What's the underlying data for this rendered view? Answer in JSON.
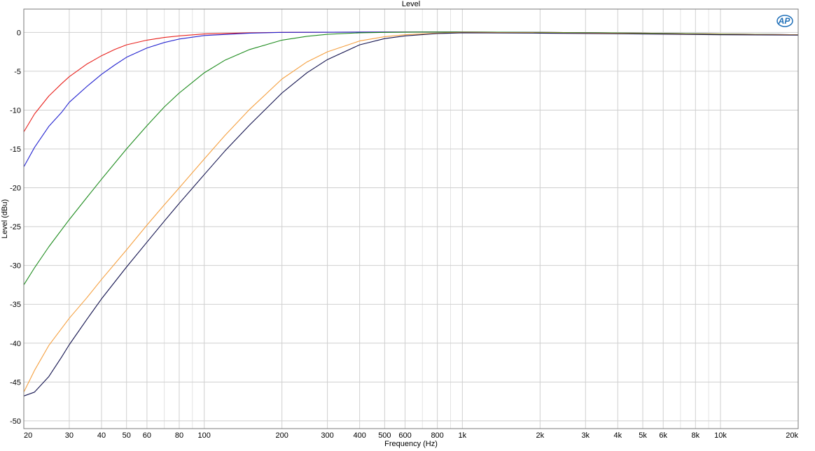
{
  "chart_data": {
    "type": "line",
    "title": "Level",
    "xlabel": "Frequency (Hz)",
    "ylabel": "Level (dBu)",
    "xscale": "log",
    "xlim": [
      20,
      20000
    ],
    "ylim": [
      -51,
      3
    ],
    "grid": true,
    "logo_text": "AP",
    "x_ticks": [
      {
        "value": 20,
        "label": "20"
      },
      {
        "value": 30,
        "label": "30"
      },
      {
        "value": 40,
        "label": "40"
      },
      {
        "value": 50,
        "label": "50"
      },
      {
        "value": 60,
        "label": "60"
      },
      {
        "value": 80,
        "label": "80"
      },
      {
        "value": 100,
        "label": "100"
      },
      {
        "value": 200,
        "label": "200"
      },
      {
        "value": 300,
        "label": "300"
      },
      {
        "value": 400,
        "label": "400"
      },
      {
        "value": 500,
        "label": "500"
      },
      {
        "value": 600,
        "label": "600"
      },
      {
        "value": 800,
        "label": "800"
      },
      {
        "value": 1000,
        "label": "1k"
      },
      {
        "value": 2000,
        "label": "2k"
      },
      {
        "value": 3000,
        "label": "3k"
      },
      {
        "value": 4000,
        "label": "4k"
      },
      {
        "value": 5000,
        "label": "5k"
      },
      {
        "value": 6000,
        "label": "6k"
      },
      {
        "value": 8000,
        "label": "8k"
      },
      {
        "value": 10000,
        "label": "10k"
      },
      {
        "value": 20000,
        "label": "20k"
      }
    ],
    "y_ticks": [
      0,
      -5,
      -10,
      -15,
      -20,
      -25,
      -30,
      -35,
      -40,
      -45,
      -50
    ],
    "series": [
      {
        "color": "#e8201c",
        "x": [
          20,
          22,
          25,
          28,
          30,
          35,
          40,
          45,
          50,
          60,
          70,
          80,
          100,
          150,
          200,
          500,
          1000,
          2000,
          5000,
          10000,
          20000
        ],
        "y": [
          -12.8,
          -10.5,
          -8.2,
          -6.6,
          -5.7,
          -4.1,
          -3.0,
          -2.2,
          -1.6,
          -1.0,
          -0.65,
          -0.45,
          -0.2,
          -0.05,
          0.0,
          0.05,
          0.05,
          0.0,
          -0.1,
          -0.2,
          -0.3
        ]
      },
      {
        "color": "#2424d0",
        "x": [
          20,
          22,
          25,
          28,
          30,
          35,
          40,
          45,
          50,
          60,
          70,
          80,
          100,
          150,
          200,
          500,
          1000,
          2000,
          5000,
          10000,
          20000
        ],
        "y": [
          -17.3,
          -14.8,
          -12.1,
          -10.3,
          -9.0,
          -7.0,
          -5.4,
          -4.2,
          -3.2,
          -2.0,
          -1.3,
          -0.85,
          -0.4,
          -0.1,
          0.0,
          0.05,
          0.05,
          0.0,
          -0.1,
          -0.2,
          -0.3
        ]
      },
      {
        "color": "#1e8c1e",
        "x": [
          20,
          22,
          25,
          30,
          35,
          40,
          50,
          60,
          70,
          80,
          100,
          120,
          150,
          200,
          250,
          300,
          400,
          500,
          700,
          1000,
          2000,
          5000,
          10000,
          20000
        ],
        "y": [
          -32.5,
          -30.3,
          -27.6,
          -24.1,
          -21.3,
          -18.9,
          -15.0,
          -12.0,
          -9.6,
          -7.8,
          -5.2,
          -3.6,
          -2.2,
          -1.0,
          -0.5,
          -0.25,
          -0.05,
          0.0,
          0.05,
          0.05,
          0.0,
          -0.1,
          -0.2,
          -0.3
        ]
      },
      {
        "color": "#f5a040",
        "x": [
          20,
          22,
          25,
          30,
          35,
          40,
          50,
          60,
          70,
          80,
          100,
          120,
          150,
          200,
          250,
          300,
          400,
          500,
          600,
          800,
          1000,
          2000,
          5000,
          10000,
          20000
        ],
        "y": [
          -46.3,
          -43.5,
          -40.3,
          -36.8,
          -34.2,
          -31.8,
          -28.0,
          -24.8,
          -22.2,
          -20.0,
          -16.3,
          -13.3,
          -9.9,
          -6.0,
          -3.8,
          -2.5,
          -1.1,
          -0.55,
          -0.3,
          -0.1,
          0.0,
          -0.05,
          -0.15,
          -0.25,
          -0.3
        ]
      },
      {
        "color": "#12124e",
        "x": [
          20,
          22,
          25,
          28,
          30,
          35,
          40,
          50,
          60,
          70,
          80,
          100,
          120,
          150,
          200,
          250,
          300,
          400,
          500,
          600,
          800,
          1000,
          2000,
          5000,
          10000,
          20000
        ],
        "y": [
          -46.8,
          -46.3,
          -44.3,
          -41.8,
          -40.2,
          -37.0,
          -34.3,
          -30.2,
          -27.0,
          -24.3,
          -22.0,
          -18.3,
          -15.3,
          -11.9,
          -7.8,
          -5.2,
          -3.5,
          -1.6,
          -0.8,
          -0.45,
          -0.15,
          -0.05,
          -0.1,
          -0.2,
          -0.3,
          -0.35
        ]
      }
    ]
  }
}
